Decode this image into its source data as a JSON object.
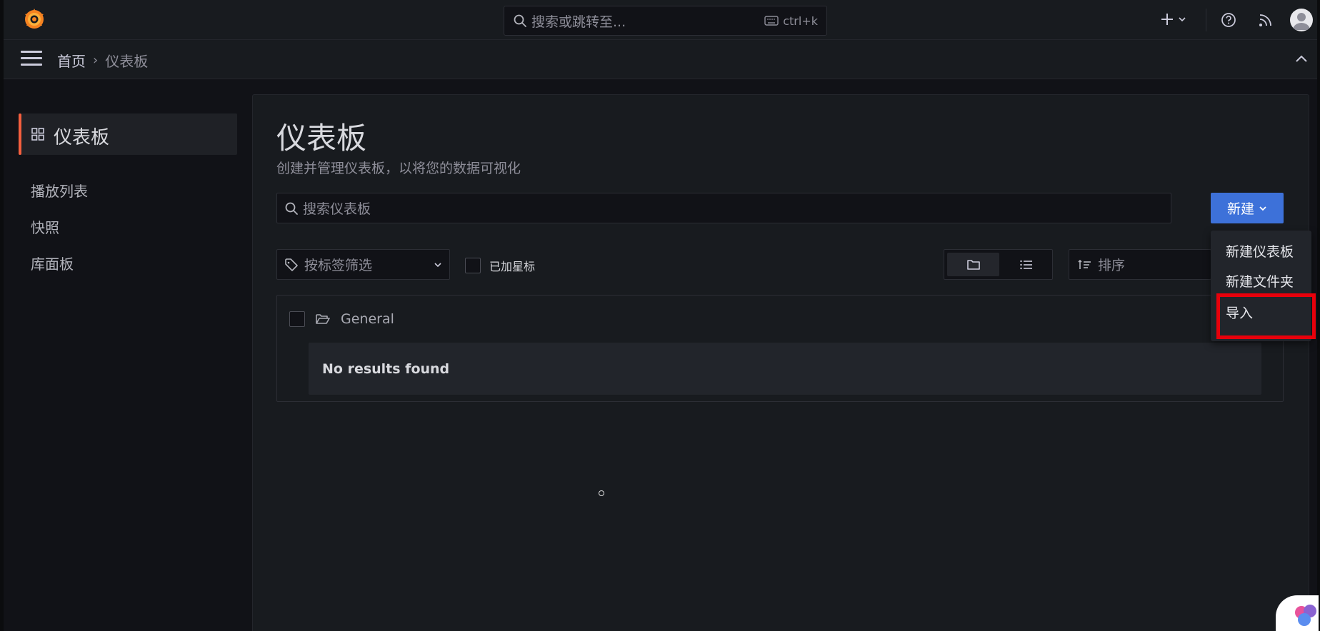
{
  "topbar": {
    "search_placeholder": "搜索或跳转至...",
    "shortcut": "ctrl+k"
  },
  "breadcrumb": {
    "home": "首页",
    "current": "仪表板"
  },
  "subnav": {
    "active_label": "仪表板",
    "items": [
      {
        "label": "播放列表"
      },
      {
        "label": "快照"
      },
      {
        "label": "库面板"
      }
    ]
  },
  "page": {
    "title": "仪表板",
    "subtitle": "创建并管理仪表板，以将您的数据可视化",
    "search_placeholder": "搜索仪表板",
    "new_button": "新建",
    "tag_filter_placeholder": "按标签筛选",
    "starred_label": "已加星标",
    "sort_placeholder": "排序"
  },
  "results": {
    "folder_name": "General",
    "empty_text": "No results found"
  },
  "new_menu": {
    "items": [
      {
        "label": "新建仪表板"
      },
      {
        "label": "新建文件夹"
      },
      {
        "label": "导入"
      }
    ]
  },
  "colors": {
    "accent_orange": "#f55f3e",
    "primary_blue": "#3d71d9",
    "highlight_red": "#e8000b",
    "background": "#111217",
    "panel": "#181b1f"
  }
}
